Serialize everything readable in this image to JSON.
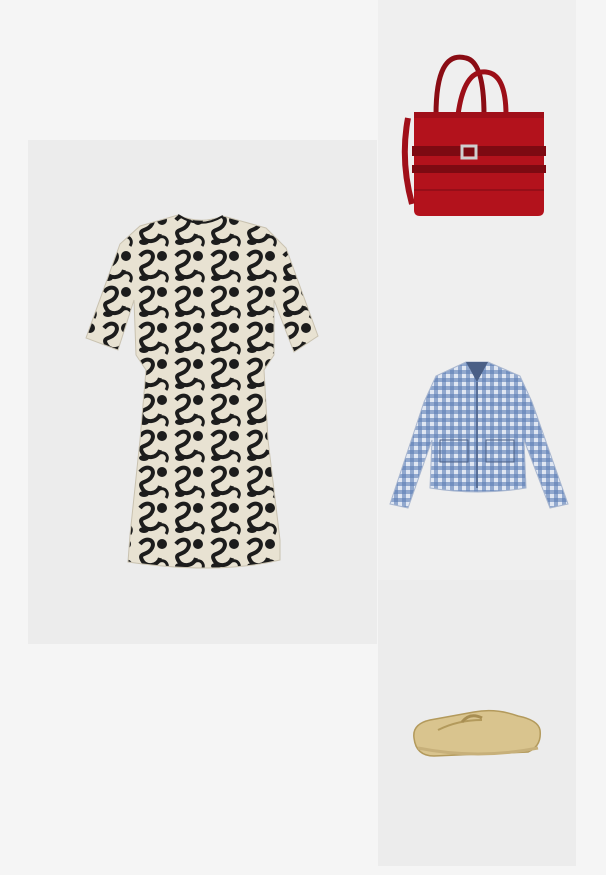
{
  "products": [
    {
      "id": "dress",
      "icon": "floral-print-dress-image",
      "colors": {
        "background": "#ececec",
        "base": "#e8e2d2",
        "print": "#1c1c1c"
      }
    },
    {
      "id": "bag",
      "icon": "red-suede-tote-bag-image",
      "colors": {
        "background": "#efefef",
        "main": "#b3121c",
        "dark": "#7d0a12",
        "hardware": "#cfcfcf"
      }
    },
    {
      "id": "shirt",
      "icon": "blue-gingham-shirt-jacket-image",
      "colors": {
        "background": "#efefef",
        "base": "#dfe6f2",
        "check": "#5d7fb6"
      }
    },
    {
      "id": "shoe",
      "icon": "gold-loafer-image",
      "colors": {
        "background": "#ececec",
        "main": "#d9c48e",
        "shade": "#b39a5c"
      }
    }
  ]
}
